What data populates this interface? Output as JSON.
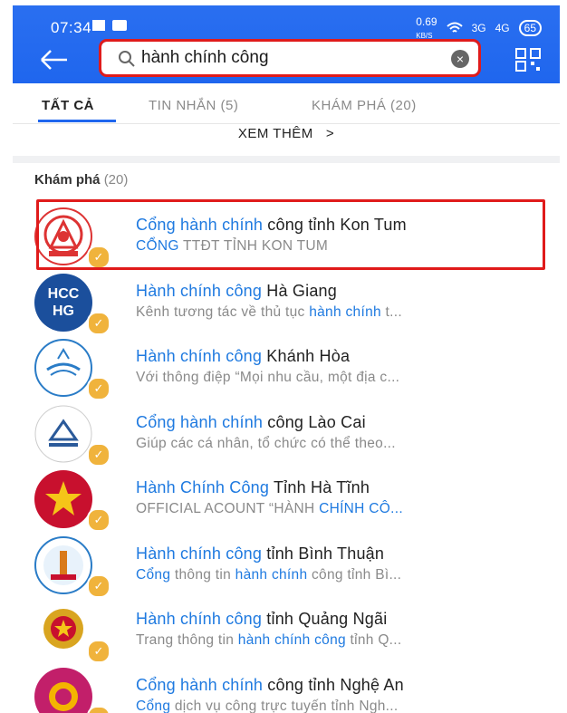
{
  "status": {
    "time": "07:34",
    "speed": "0.69",
    "speed_unit": "KB/S",
    "net1": "3G",
    "net2": "4G",
    "battery": "65"
  },
  "search": {
    "value": "hành chính công",
    "placeholder": ""
  },
  "tabs": [
    {
      "label": "TẤT CẢ"
    },
    {
      "label": "TIN NHẮN (5)"
    },
    {
      "label": "KHÁM PHÁ (20)"
    }
  ],
  "more": {
    "label": "XEM THÊM",
    "arrow": ">"
  },
  "section": {
    "title": "Khám phá",
    "count": "(20)"
  },
  "results": [
    {
      "icon": "kon-tum-emblem-icon",
      "title": [
        [
          "Cổng hành chính",
          true
        ],
        [
          " công tỉnh Kon Tum",
          false
        ]
      ],
      "desc": [
        [
          "CỔNG",
          true
        ],
        [
          " TTĐT TỈNH KON TUM",
          false
        ]
      ]
    },
    {
      "icon": "hcc-hg-logo-icon",
      "logo_text": "HCC\nHG",
      "title": [
        [
          "Hành chính công",
          true
        ],
        [
          " Hà Giang",
          false
        ]
      ],
      "desc": [
        [
          "Kênh tương tác về thủ tục ",
          false
        ],
        [
          "hành chính",
          true
        ],
        [
          " t...",
          false
        ]
      ]
    },
    {
      "icon": "khanh-hoa-logo-icon",
      "title": [
        [
          "Hành chính công",
          true
        ],
        [
          " Khánh Hòa",
          false
        ]
      ],
      "desc": [
        [
          "Với thông điệp “Mọi nhu cầu, một địa c...",
          false
        ]
      ]
    },
    {
      "icon": "lao-cai-logo-icon",
      "title": [
        [
          "Cổng hành chính",
          true
        ],
        [
          " công Lào Cai",
          false
        ]
      ],
      "desc": [
        [
          "Giúp các cá nhân, tổ chức có thể theo...",
          false
        ]
      ]
    },
    {
      "icon": "ha-tinh-logo-icon",
      "title": [
        [
          "Hành Chính Công",
          true
        ],
        [
          " Tỉnh Hà Tĩnh",
          false
        ]
      ],
      "desc": [
        [
          "OFFICIAL ACOUNT “HÀNH ",
          false
        ],
        [
          "CHÍNH CÔ...",
          true
        ]
      ]
    },
    {
      "icon": "binh-thuan-logo-icon",
      "title": [
        [
          "Hành chính công",
          true
        ],
        [
          " tỉnh Bình Thuận",
          false
        ]
      ],
      "desc": [
        [
          "Cổng",
          true
        ],
        [
          " thông tin ",
          false
        ],
        [
          "hành chính",
          true
        ],
        [
          " công tỉnh Bì...",
          false
        ]
      ]
    },
    {
      "icon": "quang-ngai-emblem-icon",
      "title": [
        [
          "Hành chính công",
          true
        ],
        [
          " tỉnh Quảng Ngãi",
          false
        ]
      ],
      "desc": [
        [
          "Trang thông tin ",
          false
        ],
        [
          "hành chính công",
          true
        ],
        [
          " tỉnh Q...",
          false
        ]
      ]
    },
    {
      "icon": "nghe-an-logo-icon",
      "title": [
        [
          "Cổng hành chính",
          true
        ],
        [
          " công tỉnh Nghệ An",
          false
        ]
      ],
      "desc": [
        [
          "Cổng",
          true
        ],
        [
          " dịch vụ công trực tuyến tỉnh Ngh...",
          false
        ]
      ]
    }
  ],
  "colors": {
    "header": "#1f66ee",
    "highlight": "#1f7ae0",
    "annotation": "#e01b1b",
    "badge": "#f0b33c"
  }
}
